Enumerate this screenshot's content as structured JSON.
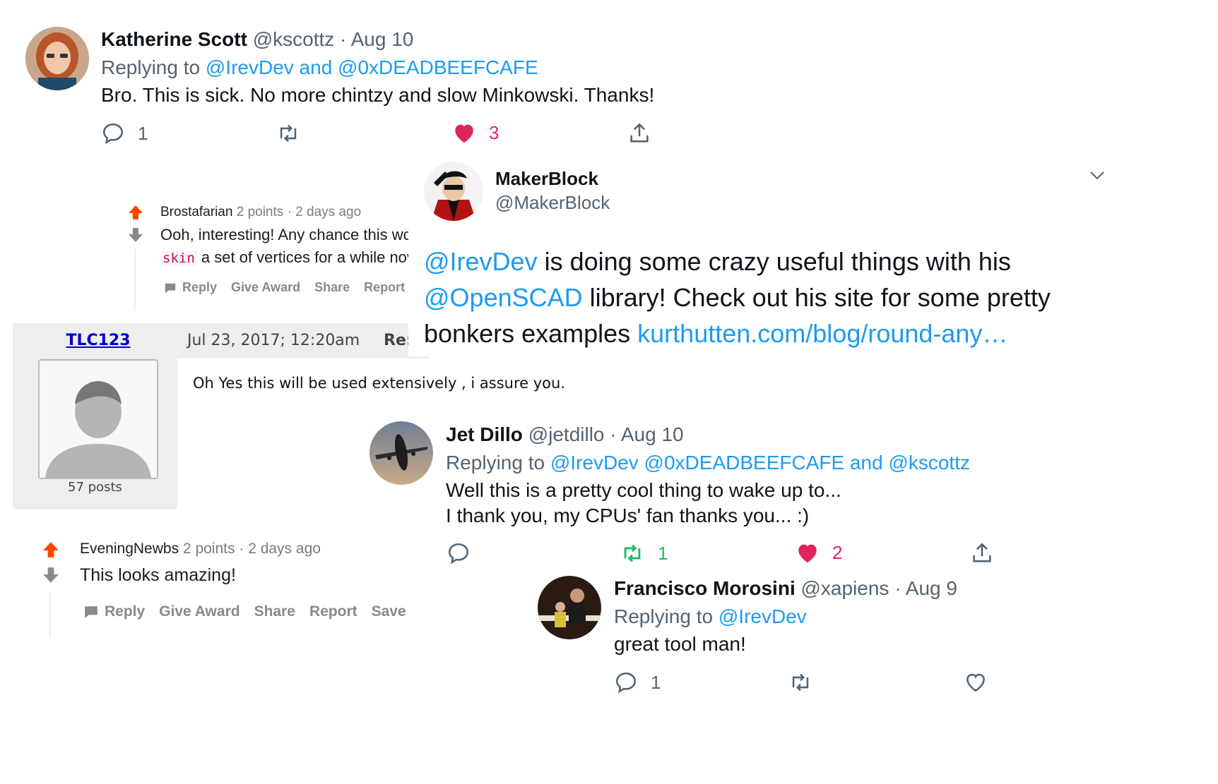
{
  "tweet1": {
    "name": "Katherine Scott",
    "handle": "@kscottz",
    "sep": "·",
    "date": "Aug 10",
    "replying_prefix": "Replying to",
    "replying_to": "@IrevDev and @0xDEADBEEFCAFE",
    "text": "Bro. This is sick. No more chintzy and slow Minkowski. Thanks!",
    "reply_count": "1",
    "like_count": "3",
    "icons": [
      "reply-icon",
      "retweet-icon",
      "heart-filled-icon",
      "share-icon"
    ],
    "colors": {
      "like": "#e0245e",
      "link": "#1d9bf0"
    }
  },
  "reddit1": {
    "user": "Brostafarian",
    "points": "2 points",
    "sep": "·",
    "age": "2 days ago",
    "line1": "Ooh, interesting! Any chance this wc",
    "code": "skin",
    "line2": "a set of vertices for a while nov",
    "actions": {
      "reply": "Reply",
      "award": "Give Award",
      "share": "Share",
      "report": "Report"
    }
  },
  "forum": {
    "username": "TLC123",
    "date": "Jul 23, 2017; 12:20am",
    "cut_label": "Re:",
    "posts": "57 posts",
    "text": "Oh Yes this will be used extensively , i assure you."
  },
  "tweet2": {
    "name": "MakerBlock",
    "handle": "@MakerBlock",
    "mention1": "@IrevDev",
    "text1": " is doing some crazy useful things with his",
    "mention2": "@OpenSCAD",
    "text2": " library!  Check out his site for some pretty",
    "text3": "bonkers examples ",
    "link": "kurthutten.com/blog/round-any…"
  },
  "tweet3": {
    "name": "Jet Dillo",
    "handle": "@jetdillo",
    "sep": "·",
    "date": "Aug 10",
    "replying_prefix": "Replying to",
    "replying_to": "@IrevDev @0xDEADBEEFCAFE and @kscottz",
    "line1": "Well this is a pretty cool thing to wake up to...",
    "line2": "I thank you, my CPUs' fan thanks you... :)",
    "retweet_count": "1",
    "like_count": "2",
    "colors": {
      "retweet": "#17bf63",
      "like": "#e0245e"
    }
  },
  "reddit2": {
    "user": "EveningNewbs",
    "points": "2 points",
    "sep": "·",
    "age": "2 days ago",
    "text": "This looks amazing!",
    "actions": {
      "reply": "Reply",
      "award": "Give Award",
      "share": "Share",
      "report": "Report",
      "save": "Save"
    }
  },
  "tweet4": {
    "name": "Francisco Morosini",
    "handle": "@xapiens",
    "sep": "·",
    "date": "Aug 9",
    "replying_prefix": "Replying to",
    "replying_to": "@IrevDev",
    "text": "great tool man!",
    "reply_count": "1"
  }
}
